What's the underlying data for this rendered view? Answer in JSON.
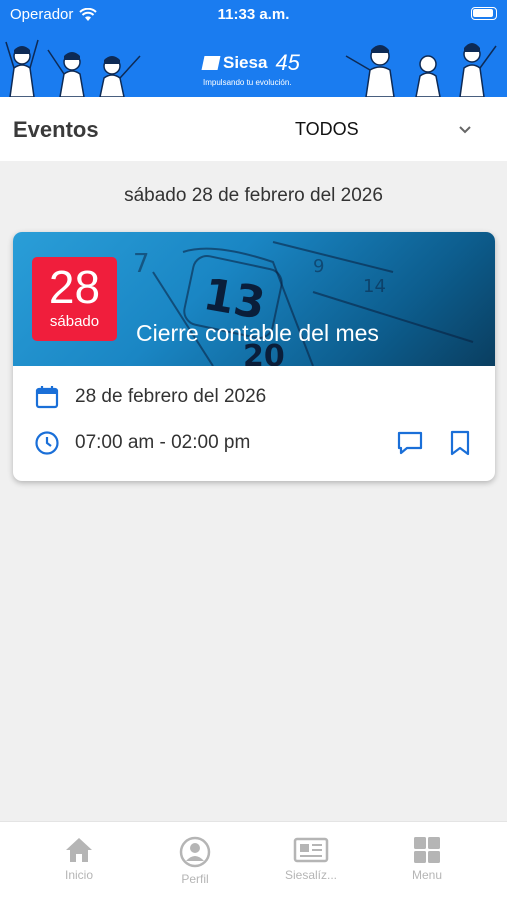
{
  "status_bar": {
    "carrier": "Operador",
    "time": "11:33 a.m."
  },
  "banner": {
    "brand": "Siesa",
    "anniversary": "45",
    "tagline": "Impulsando tu evolución."
  },
  "header": {
    "title": "Eventos",
    "filter_value": "TODOS"
  },
  "date_heading": "sábado 28 de febrero del 2026",
  "event": {
    "day": "28",
    "weekday": "sábado",
    "title": "Cierre contable del mes",
    "date_text": "28 de febrero del 2026",
    "time_text": "07:00 am - 02:00 pm"
  },
  "tabs": [
    {
      "label": "Inicio",
      "icon": "home-icon"
    },
    {
      "label": "Perfil",
      "icon": "profile-icon"
    },
    {
      "label": "Siesalíz...",
      "icon": "news-icon"
    },
    {
      "label": "Menu",
      "icon": "grid-icon"
    }
  ],
  "colors": {
    "brand_blue": "#1a7cf0",
    "accent_red": "#f01e3c",
    "icon_blue": "#1a6fd8",
    "tab_gray": "#b5b5b5"
  }
}
